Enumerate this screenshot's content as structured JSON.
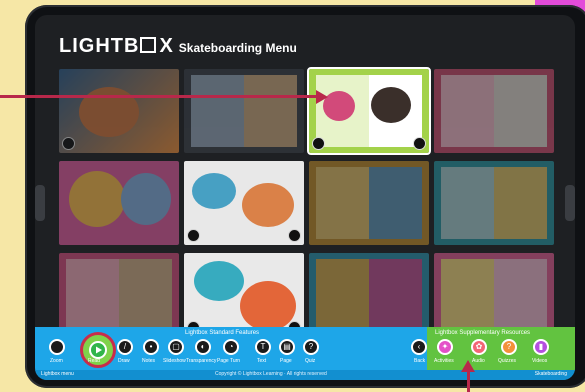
{
  "header": {
    "logo_text": "LIGHTB",
    "logo_x": "X",
    "menu_title": "Skateboarding Menu"
  },
  "toolbar": {
    "standard_title": "Lightbox Standard Features",
    "supplementary_title": "Lightbox Supplementary Resources",
    "standard_tools": [
      {
        "label": "Zoom",
        "icon": "zoom-icon"
      },
      {
        "label": "Read",
        "icon": "play-icon"
      },
      {
        "label": "Draw",
        "icon": "pen-icon"
      },
      {
        "label": "Notes",
        "icon": "notes-icon"
      },
      {
        "label": "Slideshow",
        "icon": "slideshow-icon"
      },
      {
        "label": "Transparency",
        "icon": "transparency-icon"
      },
      {
        "label": "Page Turn",
        "icon": "page-turn-icon"
      },
      {
        "label": "Text",
        "icon": "text-icon"
      },
      {
        "label": "Page",
        "icon": "page-icon"
      },
      {
        "label": "Quiz",
        "icon": "quiz-icon"
      }
    ],
    "supplementary_tools": [
      {
        "label": "Back",
        "icon": "back-icon"
      },
      {
        "label": "Activities",
        "icon": "activities-icon"
      },
      {
        "label": "Audio",
        "icon": "audio-icon"
      },
      {
        "label": "Quizzes",
        "icon": "quizzes-icon"
      },
      {
        "label": "Videos",
        "icon": "videos-icon"
      }
    ]
  },
  "footer": {
    "left": "Lightbox menu",
    "copyright": "Copyright © Lightbox Learning · All rights reserved",
    "right": "Skateboarding"
  },
  "colors": {
    "toolbar_blue": "#1ea6e8",
    "supplementary_green": "#62c340",
    "highlight_red": "#c82c4b"
  }
}
